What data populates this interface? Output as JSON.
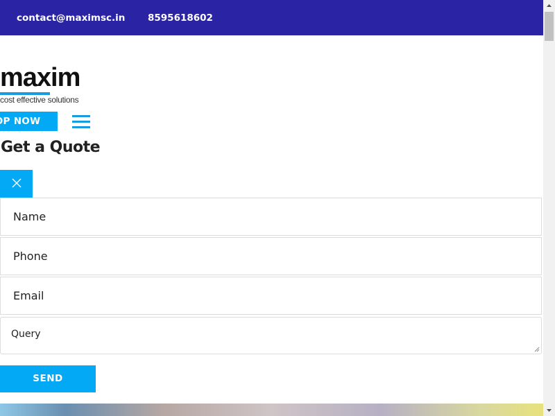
{
  "topbar": {
    "email": "contact@maximsc.in",
    "phone": "8595618602"
  },
  "logo": {
    "word": "maxim",
    "tagline": "cost effective solutions"
  },
  "header": {
    "shop_label": "OP NOW"
  },
  "form": {
    "title": "Get a Quote",
    "name_placeholder": "Name",
    "phone_placeholder": "Phone",
    "email_placeholder": "Email",
    "query_placeholder": "Query",
    "send_label": "SEND"
  },
  "colors": {
    "topbar": "#2a24a4",
    "accent": "#03a9f4"
  },
  "icons": {
    "close": "close-icon",
    "menu": "hamburger-menu-icon"
  }
}
